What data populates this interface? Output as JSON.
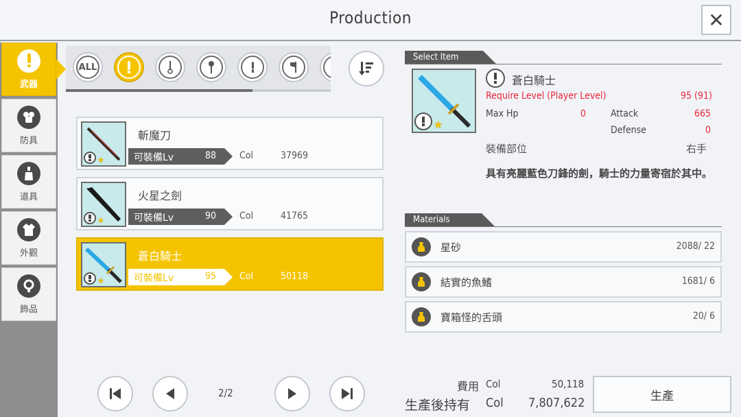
{
  "header": {
    "title": "Production",
    "close_label": "✕"
  },
  "sidebar": {
    "items": [
      {
        "label": "武器",
        "icon": "sword-icon",
        "active": true
      },
      {
        "label": "防具",
        "icon": "armor-icon",
        "active": false
      },
      {
        "label": "道具",
        "icon": "potion-icon",
        "active": false
      },
      {
        "label": "外觀",
        "icon": "outfit-icon",
        "active": false
      },
      {
        "label": "飾品",
        "icon": "ring-icon",
        "active": false
      }
    ]
  },
  "filters": {
    "all_label": "ALL",
    "items": [
      "all",
      "one-handed-sword",
      "rapier",
      "mace",
      "dagger",
      "axe",
      "more"
    ],
    "active_index": 1
  },
  "list": {
    "items": [
      {
        "name": "斬魔刀",
        "lv_label": "可裝備Lv",
        "lv": "88",
        "col_label": "Col",
        "col": "37969"
      },
      {
        "name": "火星之劍",
        "lv_label": "可裝備Lv",
        "lv": "90",
        "col_label": "Col",
        "col": "41765"
      },
      {
        "name": "蒼白騎士",
        "lv_label": "可裝備Lv",
        "lv": "95",
        "col_label": "Col",
        "col": "50118"
      }
    ],
    "selected_index": 2
  },
  "pager": {
    "page": "2/2"
  },
  "detail": {
    "section_title": "Select Item",
    "name": "蒼白騎士",
    "require_label": "Require Level (Player Level)",
    "require_value": "95 (91)",
    "maxhp_label": "Max Hp",
    "maxhp_value": "0",
    "attack_label": "Attack",
    "attack_value": "665",
    "defense_label": "Defense",
    "defense_value": "0",
    "slot_label": "裝備部位",
    "slot_value": "右手",
    "description": "具有亮麗藍色刀鋒的劍，騎士的力量寄宿於其中。"
  },
  "materials": {
    "section_title": "Materials",
    "items": [
      {
        "name": "星砂",
        "count": "2088/ 22"
      },
      {
        "name": "結實的魚鰭",
        "count": "1681/ 6"
      },
      {
        "name": "寶箱怪的舌頭",
        "count": "20/ 6"
      }
    ]
  },
  "cost": {
    "fee_label": "費用",
    "fee_unit": "Col",
    "fee_value": "50,118",
    "held_label": "生產後持有",
    "held_unit": "Col",
    "held_value": "7,807,622",
    "produce_label": "生產"
  },
  "colors": {
    "accent": "#f5c400",
    "danger": "#e8253a",
    "sidebar": "#8e8e8e"
  }
}
